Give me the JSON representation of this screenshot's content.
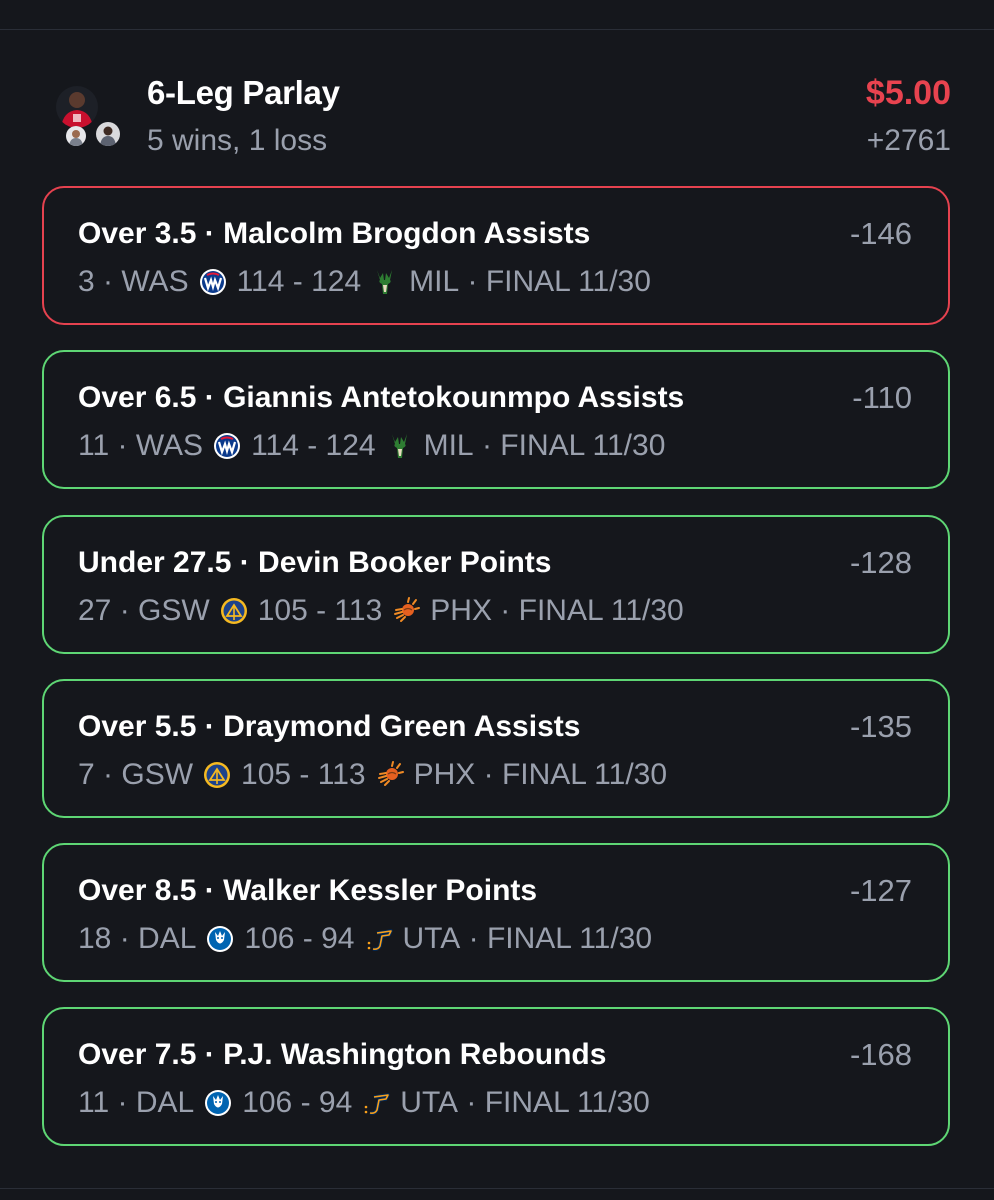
{
  "parlay": {
    "title": "6-Leg Parlay",
    "record": "5 wins, 1 loss",
    "stake": "$5.00",
    "odds": "+2761"
  },
  "colors": {
    "loss": "#e5424f",
    "win": "#5ed674",
    "stake": "#e8434f",
    "muted": "#9aa0ad"
  },
  "legs": [
    {
      "pick": "Over 3.5 · Malcolm Brogdon Assists",
      "odds": "-146",
      "result": "3",
      "away_team": "WAS",
      "away_logo": "wizards-logo-icon",
      "score": "114 - 124",
      "home_logo": "bucks-logo-icon",
      "home_team": "MIL",
      "status": "FINAL 11/30",
      "outcome": "loss"
    },
    {
      "pick": "Over 6.5 · Giannis Antetokounmpo Assists",
      "odds": "-110",
      "result": "11",
      "away_team": "WAS",
      "away_logo": "wizards-logo-icon",
      "score": "114 - 124",
      "home_logo": "bucks-logo-icon",
      "home_team": "MIL",
      "status": "FINAL 11/30",
      "outcome": "win"
    },
    {
      "pick": "Under 27.5 · Devin Booker Points",
      "odds": "-128",
      "result": "27",
      "away_team": "GSW",
      "away_logo": "warriors-logo-icon",
      "score": "105 - 113",
      "home_logo": "suns-logo-icon",
      "home_team": "PHX",
      "status": "FINAL 11/30",
      "outcome": "win"
    },
    {
      "pick": "Over 5.5 · Draymond Green Assists",
      "odds": "-135",
      "result": "7",
      "away_team": "GSW",
      "away_logo": "warriors-logo-icon",
      "score": "105 - 113",
      "home_logo": "suns-logo-icon",
      "home_team": "PHX",
      "status": "FINAL 11/30",
      "outcome": "win"
    },
    {
      "pick": "Over 8.5 · Walker Kessler Points",
      "odds": "-127",
      "result": "18",
      "away_team": "DAL",
      "away_logo": "mavericks-logo-icon",
      "score": "106 - 94",
      "home_logo": "jazz-logo-icon",
      "home_team": "UTA",
      "status": "FINAL 11/30",
      "outcome": "win"
    },
    {
      "pick": "Over 7.5 · P.J. Washington Rebounds",
      "odds": "-168",
      "result": "11",
      "away_team": "DAL",
      "away_logo": "mavericks-logo-icon",
      "score": "106 - 94",
      "home_logo": "jazz-logo-icon",
      "home_team": "UTA",
      "status": "FINAL 11/30",
      "outcome": "win"
    }
  ]
}
